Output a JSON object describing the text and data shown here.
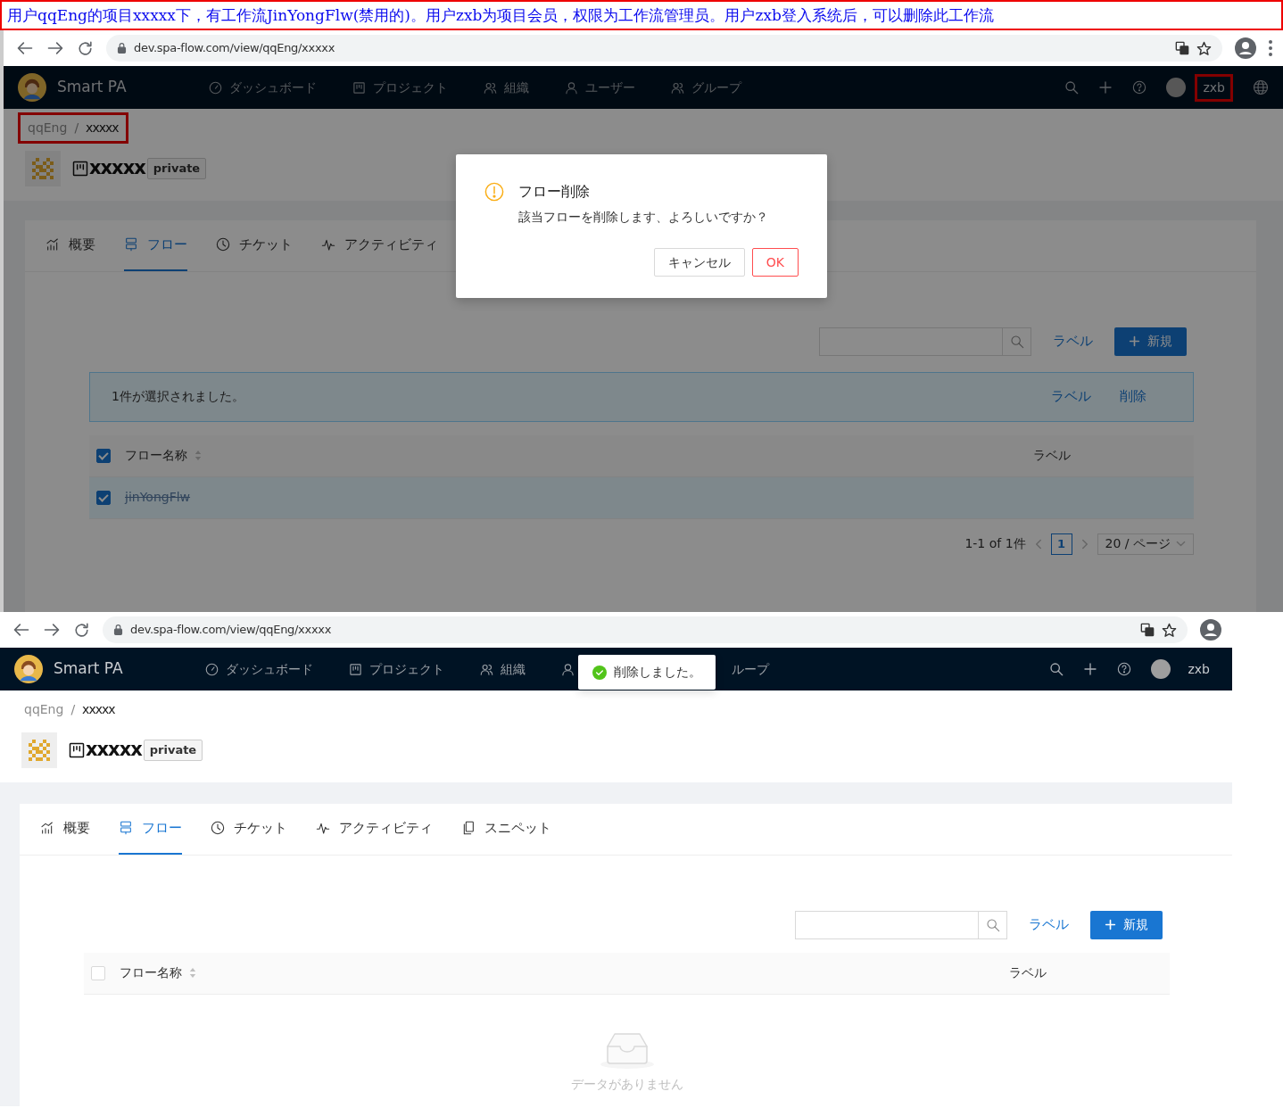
{
  "annotation": {
    "text": "用户qqEng的项目xxxxx下，有工作流JinYongFlw(禁用的)。用户zxb为项目会员，权限为工作流管理员。用户zxb登入系统后，可以删除此工作流"
  },
  "screens": [
    {
      "browser": {
        "url": "dev.spa-flow.com/view/qqEng/xxxxx",
        "menu_button": true
      },
      "navbar": {
        "brand": "Smart PA",
        "items": [
          {
            "label": "ダッシュボード"
          },
          {
            "label": "プロジェクト"
          },
          {
            "label": "組織"
          },
          {
            "label": "ユーザー"
          },
          {
            "label": "グループ"
          }
        ],
        "user": {
          "name": "zxb",
          "highlighted": true
        },
        "language_button": true
      },
      "breadcrumb": {
        "items": [
          "qqEng",
          "xxxxx"
        ],
        "separator": "/",
        "highlighted": true
      },
      "project": {
        "name": "xxxxx",
        "badge": "private"
      },
      "tabs": [
        {
          "label": "概要",
          "selected": false
        },
        {
          "label": "フロー",
          "selected": true
        },
        {
          "label": "チケット",
          "selected": false
        },
        {
          "label": "アクティビティ",
          "selected": false
        }
      ],
      "toolbar": {
        "label_link": "ラベル",
        "new_button": "新規"
      },
      "selection_bar": {
        "text": "1件が選択されました。",
        "actions": [
          "ラベル",
          "削除"
        ]
      },
      "table": {
        "columns": [
          "フロー名称",
          "ラベル"
        ],
        "all_checked": true,
        "rows": [
          {
            "name": "jinYongFlw",
            "checked": true,
            "selected": true,
            "disabled": true
          }
        ]
      },
      "pagination": {
        "summary": "1-1 of 1件",
        "pages": [
          {
            "label": "1",
            "selected": true
          }
        ],
        "page_size": "20 / ページ"
      },
      "dialog": {
        "title": "フロー削除",
        "message": "該当フローを削除します、よろしいですか？",
        "buttons": [
          "キャンセル",
          "OK"
        ]
      }
    },
    {
      "browser": {
        "url": "dev.spa-flow.com/view/qqEng/xxxxx"
      },
      "navbar": {
        "brand": "Smart PA",
        "items": [
          {
            "label": "ダッシュボード"
          },
          {
            "label": "プロジェクト"
          },
          {
            "label": "組織"
          },
          {
            "covered": true
          },
          {
            "label": "ループ",
            "covered": true
          }
        ],
        "user": {
          "name": "zxb",
          "highlighted": false
        }
      },
      "breadcrumb": {
        "items": [
          "qqEng",
          "xxxxx"
        ],
        "separator": "/",
        "highlighted": false
      },
      "project": {
        "name": "xxxxx",
        "badge": "private"
      },
      "tabs": [
        {
          "label": "概要",
          "selected": false
        },
        {
          "label": "フロー",
          "selected": true
        },
        {
          "label": "チケット",
          "selected": false
        },
        {
          "label": "アクティビティ",
          "selected": false
        },
        {
          "label": "スニペット",
          "selected": false
        }
      ],
      "toolbar": {
        "label_link": "ラベル",
        "new_button": "新規"
      },
      "table": {
        "columns": [
          "フロー名称",
          "ラベル"
        ],
        "all_checked": false,
        "empty_text": "データがありません"
      },
      "toast": {
        "text": "削除しました。"
      }
    }
  ]
}
